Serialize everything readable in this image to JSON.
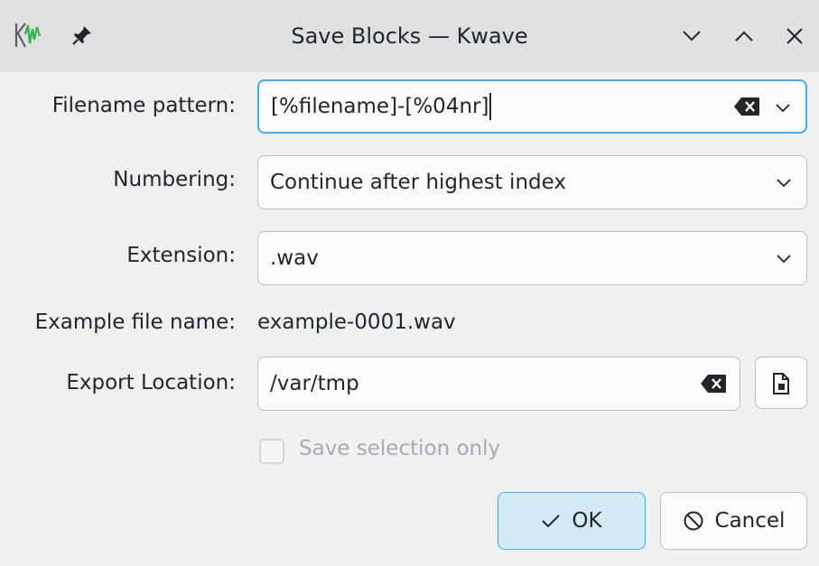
{
  "window": {
    "title": "Save Blocks — Kwave",
    "app_icon": "kwave-logo-icon",
    "buttons": [
      "pin-icon",
      "minimize-icon",
      "maximize-icon",
      "close-icon"
    ]
  },
  "form": {
    "filename_pattern": {
      "label": "Filename pattern:",
      "value": "[%filename]-[%04nr]"
    },
    "numbering": {
      "label": "Numbering:",
      "value": "Continue after highest index"
    },
    "extension": {
      "label": "Extension:",
      "value": ".wav"
    },
    "example": {
      "label": "Example file name:",
      "value": "example-0001.wav"
    },
    "export_location": {
      "label": "Export Location:",
      "value": "/var/tmp"
    },
    "save_selection": {
      "label": "Save selection only",
      "checked": false,
      "enabled": false
    }
  },
  "buttons": {
    "ok": "OK",
    "cancel": "Cancel"
  },
  "colors": {
    "accent": "#3daee9",
    "ok_background": "#d4e9f6",
    "window_background": "#eff0f1"
  }
}
